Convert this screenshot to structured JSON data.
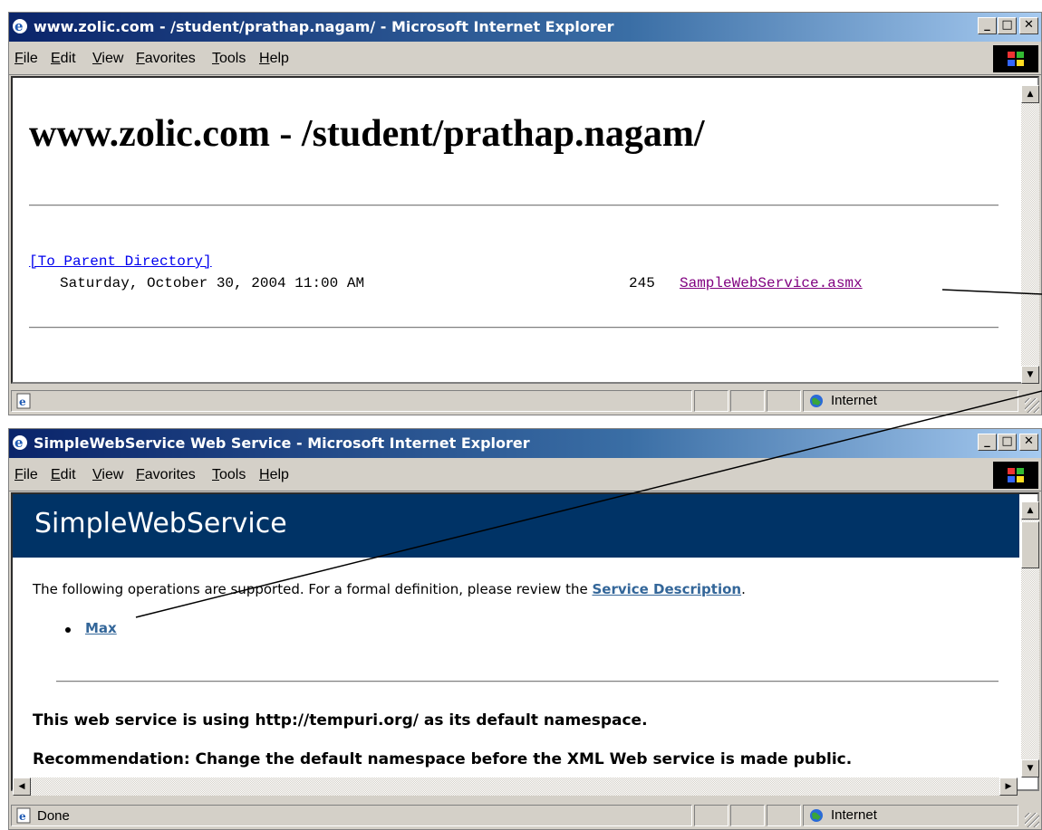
{
  "window1": {
    "title": "www.zolic.com - /student/prathap.nagam/ - Microsoft Internet Explorer",
    "menus": [
      "File",
      "Edit",
      "View",
      "Favorites",
      "Tools",
      "Help"
    ],
    "page": {
      "heading": "www.zolic.com - /student/prathap.nagam/",
      "parent_link": "[To Parent Directory]",
      "entry": {
        "date": "Saturday, October 30, 2004 11:00 AM",
        "size": "245",
        "filename": "SampleWebService.asmx"
      }
    },
    "status": {
      "text": "",
      "zone": "Internet"
    }
  },
  "window2": {
    "title": "SimpleWebService Web Service - Microsoft Internet Explorer",
    "menus": [
      "File",
      "Edit",
      "View",
      "Favorites",
      "Tools",
      "Help"
    ],
    "page": {
      "header": "SimpleWebService",
      "intro": "The following operations are supported. For a formal definition, please review the ",
      "service_description_link": "Service Description",
      "intro_end": ".",
      "operations": [
        "Max"
      ],
      "namespace_text": "This web service is using http://tempuri.org/ as its default namespace.",
      "cut_off_text": "Recommendation: Change the default namespace before the XML Web service is made public."
    },
    "status": {
      "text": "Done",
      "zone": "Internet"
    }
  },
  "colors": {
    "title_bar": "#0a246a",
    "service_header": "#003366",
    "link": "#336699",
    "visited_link": "#800080"
  }
}
